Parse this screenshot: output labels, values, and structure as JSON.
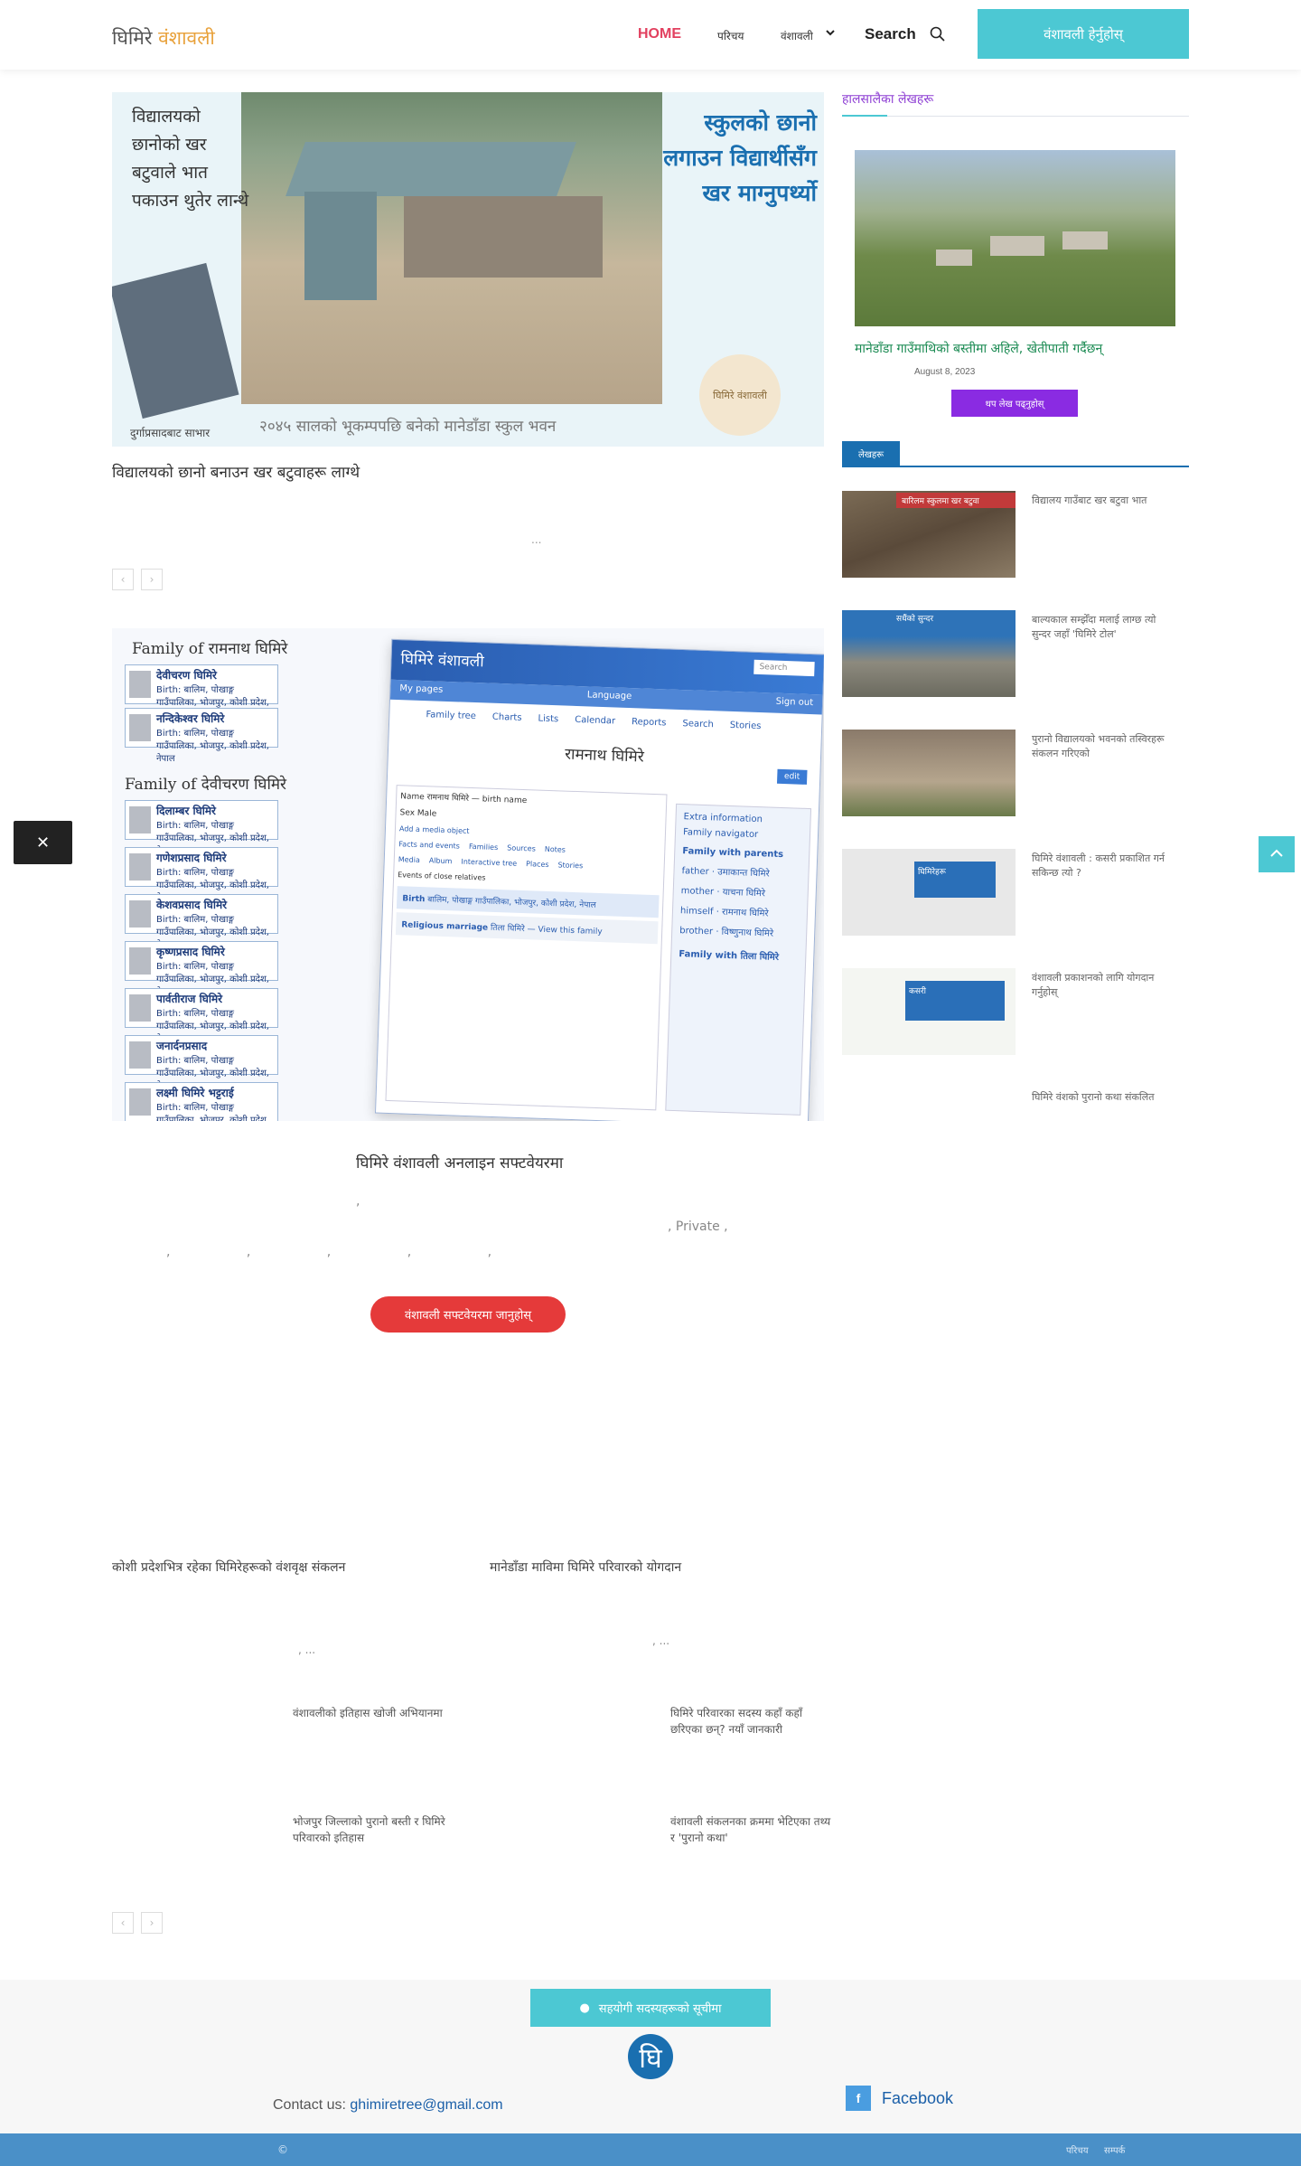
{
  "header": {
    "logo_part1": "घिमिरे",
    "logo_part2": "वंशावली",
    "nav": [
      "HOME",
      "परिचय",
      "वंशावली"
    ],
    "search_label": "Search",
    "cta_label": "वंशावली हेर्नुहोस्"
  },
  "hero": {
    "left_text": "विद्यालयको छानोको खर बटुवाले भात पकाउन थुतेर लान्थे",
    "right_text": "स्कुलको छानो लगाउन विद्यार्थीसँग खर माग्नुपर्थ्यो",
    "caption": "२०४५ सालको भूकम्पपछि बनेको मानेडाँडा स्कुल भवन",
    "book_label": "दुर्गाप्रसादबाट साभार",
    "badge_text": "घिमिरे वंशावली",
    "title": "विद्यालयको छानो बनाउन खर बटुवाहरू लाग्थे",
    "ellipsis": "..."
  },
  "pager": {
    "prev": "‹",
    "next": "›"
  },
  "tree": {
    "heading_1": "Family of रामनाथ घिमिरे",
    "heading_2": "Family of देवीचरण घिमिरे",
    "persons_1": [
      "देवीचरण घिमिरे",
      "नन्दिकेश्वर घिमिरे"
    ],
    "persons_2": [
      "दिलाम्बर घिमिरे",
      "गणेशप्रसाद घिमिरे",
      "केशवप्रसाद घिमिरे",
      "कृष्णप्रसाद घिमिरे",
      "पार्वतीराज घिमिरे",
      "जनार्दनप्रसाद",
      "लक्ष्मी घिमिरे भट्टराई"
    ],
    "birth_text": "Birth: बालिम, पोखाङ्ग गाउँपालिका, भोजपुर, कोशी प्रदेश, नेपाल",
    "app_title": "घिमिरे वंशावली",
    "app_my_pages": "My pages",
    "app_language": "Language",
    "app_sign_out": "Sign out",
    "app_search_placeholder": "Search",
    "app_icons": [
      "Family tree",
      "Charts",
      "Lists",
      "Calendar",
      "Reports",
      "Search",
      "Stories"
    ],
    "app_person": "रामनाथ घिमिरे",
    "app_edit": "edit",
    "app_name_line": "Name रामनाथ घिमिरे — birth name",
    "app_sex_line": "Sex Male",
    "app_add_media": "Add a media object",
    "app_tabs": [
      "Facts and events",
      "Families",
      "Sources",
      "Notes"
    ],
    "app_tabs2": [
      "Media",
      "Album",
      "Interactive tree",
      "Places",
      "Stories"
    ],
    "app_events_label": "Events of close relatives",
    "app_birth_label": "Birth",
    "app_birth_value": "बालिम, पोखाङ्ग गाउँपालिका, भोजपुर, कोशी प्रदेश, नेपाल",
    "app_marriage_label": "Religious marriage",
    "app_marriage_value": "तिला घिमिरे — View this family",
    "app_side_extra": "Extra information",
    "app_side_nav": "Family navigator",
    "app_side_parents": "Family with parents",
    "app_side_rows": [
      "father",
      "mother",
      "himself",
      "brother"
    ],
    "app_side_names": [
      "उमाकान्त घिमिरे",
      "याचना घिमिरे",
      "रामनाथ घिमिरे",
      "विष्णुनाथ घिमिरे"
    ],
    "app_side_with": "Family with तिला घिमिरे",
    "title": "घिमिरे वंशावली अनलाइन सफ्टवेयरमा",
    "text_line1": ",",
    "text_line2": ", Private ,",
    "text_line3": ", , , , ,",
    "button_label": "वंशावली सफ्टवेयरमा जानुहोस्"
  },
  "articles": {
    "left_title": "कोशी प्रदेशभित्र रहेका घिमिरेहरूको वंशवृक्ष संकलन",
    "right_title": "मानेडाँडा माविमा घिमिरे परिवारको योगदान",
    "left_text": ", ...",
    "right_text": ", ...",
    "mini": [
      "वंशावलीको इतिहास खोजी अभियानमा",
      "घिमिरे परिवारका सदस्य कहाँ कहाँ छरिएका छन्? नयाँ जानकारी",
      "भोजपुर जिल्लाको पुरानो बस्ती र घिमिरे परिवारको इतिहास",
      "वंशावली संकलनका क्रममा भेटिएका तथ्य र 'पुरानो कथा'"
    ]
  },
  "sidebar": {
    "heading": "हालसालैका लेखहरू",
    "featured_title": "मानेडाँडा गाउँमाथिको बस्तीमा अहिले, खेतीपाती गर्दैछन्",
    "featured_date": "August 8, 2023",
    "featured_button": "थप लेख पढ्नुहोस्",
    "tag": "लेखहरू",
    "items": [
      "विद्यालय गाउँबाट खर बटुवा भात",
      "बाल्यकाल सम्झेँदा मलाई लाग्छ त्यो सुन्दर जहाँ 'घिमिरे टोल'",
      "पुरानो विद्यालयको भवनको तस्विरहरू संकलन गरिएको",
      "घिमिरे वंशावली : कसरी प्रकाशित गर्न सकिन्छ त्यो ?",
      "वंशावली प्रकाशनको लागि योगदान गर्नुहोस्",
      "घिमिरे वंशको पुरानो कथा संकलित"
    ],
    "thumb_banners": [
      "बारिलम स्कुलमा खर बटुवा",
      "सधैंको सुन्दर",
      "घिमिरेहरू",
      "कसरी"
    ]
  },
  "footer": {
    "button_label": "सहयोगी सदस्यहरूको सूचीमा",
    "logo_glyph": "घि",
    "contact_label": "Contact us:",
    "contact_email": "ghimiretree@gmail.com",
    "fb_label": "Facebook",
    "copyright": "©",
    "bottom_links": [
      "परिचय",
      "सम्पर्क"
    ]
  },
  "floating": {
    "close": "✕"
  },
  "colors": {
    "accent": "#4cc8d3",
    "primary": "#1a6fb0",
    "red": "#e53a3a",
    "purple": "#8a2be2"
  }
}
